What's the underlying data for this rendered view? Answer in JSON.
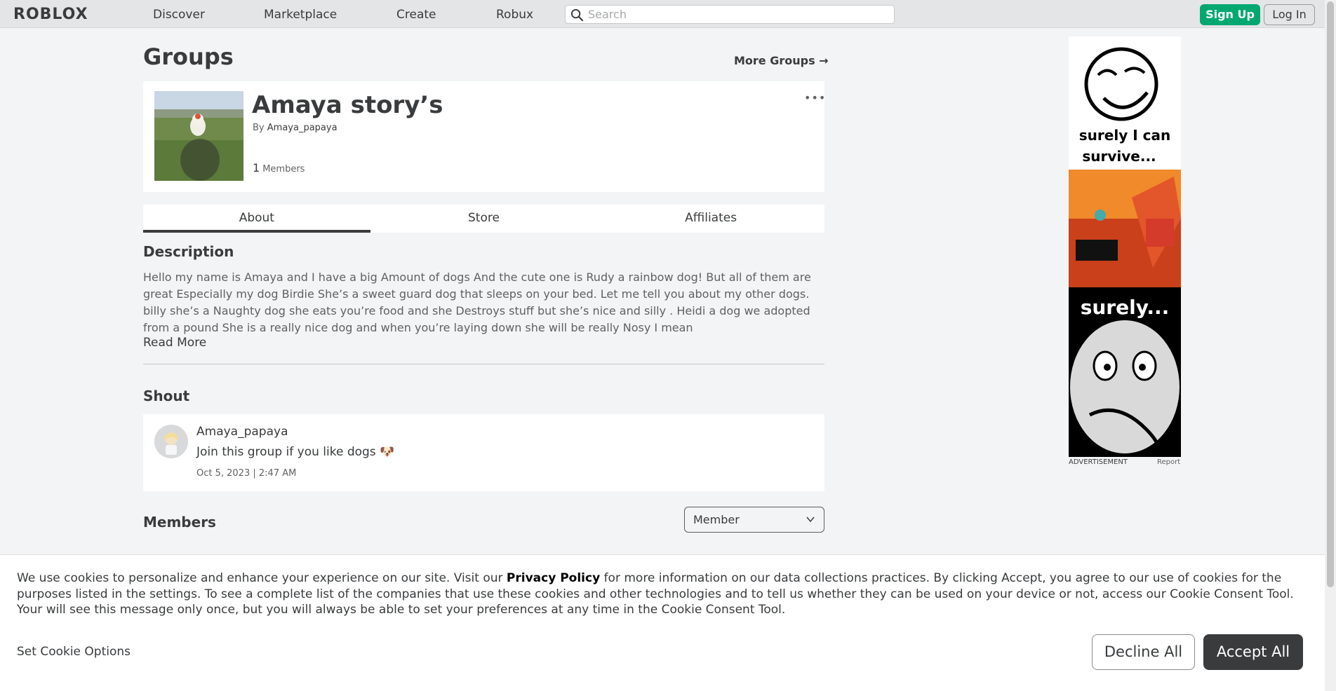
{
  "topbar": {
    "logo_text": "ROBLOX",
    "nav": [
      "Discover",
      "Marketplace",
      "Create",
      "Robux"
    ],
    "search_placeholder": "Search",
    "signup_label": "Sign Up",
    "login_label": "Log In"
  },
  "page": {
    "title": "Groups",
    "more_groups_label": "More Groups →"
  },
  "group": {
    "name": "Amaya story’s",
    "by_prefix": "By",
    "owner": "Amaya_papaya",
    "member_count": "1",
    "members_label": "Members",
    "more_options": "•••"
  },
  "tabs": [
    {
      "label": "About",
      "active": true
    },
    {
      "label": "Store",
      "active": false
    },
    {
      "label": "Affiliates",
      "active": false
    }
  ],
  "description": {
    "heading": "Description",
    "text": "Hello my name is Amaya and I have a big Amount of dogs And the cute one is Rudy a rainbow dog! But all of them are great Especially my dog Birdie She’s a sweet guard dog that sleeps on your bed. Let me tell you about my other dogs. billy she’s a Naughty dog she eats you’re food and she Destroys stuff but she’s nice and silly . Heidi a dog we adopted from a pound She is a really nice dog and when you’re laying down she will be really Nosy I mean",
    "read_more": "Read More"
  },
  "shout": {
    "heading": "Shout",
    "user": "Amaya_papaya",
    "text": "Join this group if you like dogs 🐶",
    "date": "Oct 5, 2023 | 2:47 AM"
  },
  "members": {
    "heading": "Members",
    "role_selected": "Member"
  },
  "ad": {
    "caption_top": "surely I can survive...",
    "caption_mid": "surely...",
    "label": "ADVERTISEMENT",
    "report": "Report"
  },
  "cookie": {
    "text_before": "We use cookies to personalize and enhance your experience on our site. Visit our ",
    "privacy_link": "Privacy Policy",
    "text_after": " for more information on our data collections practices. By clicking Accept, you agree to our use of cookies for the purposes listed in the settings. To see a complete list of the companies that use these cookies and other technologies and to tell us whether they can be used on your device or not, access our Cookie Consent Tool. Your will see this message only once, but you will always be able to set your preferences at any time in the Cookie Consent Tool.",
    "set_options": "Set Cookie Options",
    "decline": "Decline All",
    "accept": "Accept All"
  },
  "colors": {
    "signup_green": "#00a870",
    "accept_dark": "#393b3d",
    "page_bg": "#f2f4f5"
  }
}
